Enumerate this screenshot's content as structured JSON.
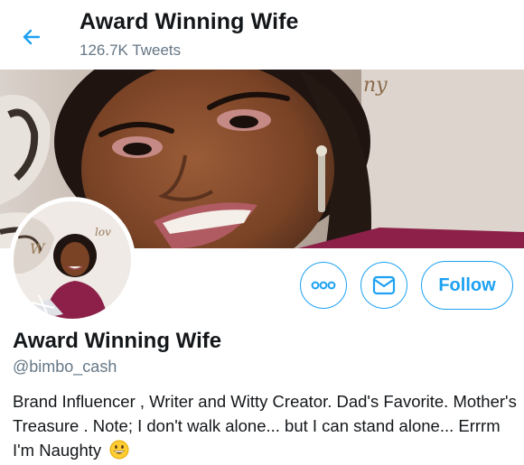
{
  "header": {
    "title": "Award Winning Wife",
    "tweet_count": "126.7K Tweets",
    "back_icon": "arrow-left-icon"
  },
  "banner": {
    "description_icon": "profile-banner-photo"
  },
  "profile": {
    "display_name": "Award Winning Wife",
    "handle": "@bimbo_cash",
    "bio": "Brand Influencer , Writer and Witty Creator. Dad's Favorite. Mother's Treasure . Note; I don't walk alone... but I can stand alone... Errrm I'm Naughty",
    "bio_emoji": "grinning-face-emoji"
  },
  "actions": {
    "more_icon": "more-options-icon",
    "message_icon": "envelope-icon",
    "follow_label": "Follow"
  },
  "colors": {
    "accent": "#1da1f2",
    "text_primary": "#14171a",
    "text_secondary": "#657786"
  }
}
